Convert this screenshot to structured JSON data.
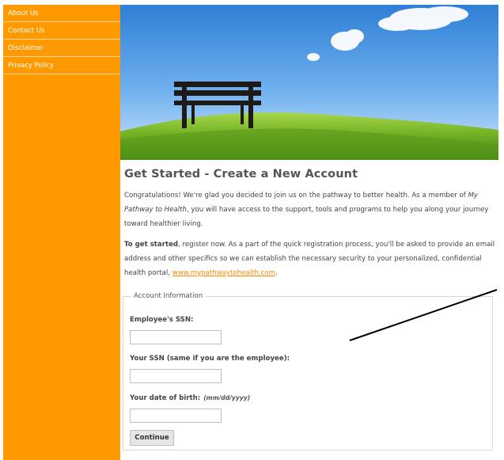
{
  "sidebar": {
    "items": [
      {
        "label": "About Us"
      },
      {
        "label": "Contact Us"
      },
      {
        "label": "Disclaimer"
      },
      {
        "label": "Privacy Policy"
      }
    ]
  },
  "main": {
    "title": "Get Started - Create a New Account",
    "intro": {
      "before": "Congratulations! We're glad you decided to join us on the pathway to better health. As a member of ",
      "program": "My Pathway to Health",
      "after": ", you will have access to the support, tools and programs to help you along your journey toward healthier living."
    },
    "register": {
      "lead": "To get started",
      "text": ", register now. As a part of the quick registration process, you'll be asked to provide an email address and other specifics so we can establish the necessary security to your personalized, confidential health portal, ",
      "link": "www.mypathwaytohealth.com",
      "end": "."
    }
  },
  "form": {
    "legend": "Account Information",
    "employee_ssn_label": "Employee's SSN:",
    "employee_ssn_value": "",
    "your_ssn_label": "Your SSN (same if you are the employee):",
    "your_ssn_value": "",
    "dob_label": "Your date of birth:",
    "dob_hint": "(mm/dd/yyyy)",
    "dob_value": "",
    "continue_label": "Continue"
  },
  "colors": {
    "sidebar": "#ff9900",
    "link": "#ff8800",
    "sky": "#3f8fe0",
    "grass": "#7ab82a"
  }
}
